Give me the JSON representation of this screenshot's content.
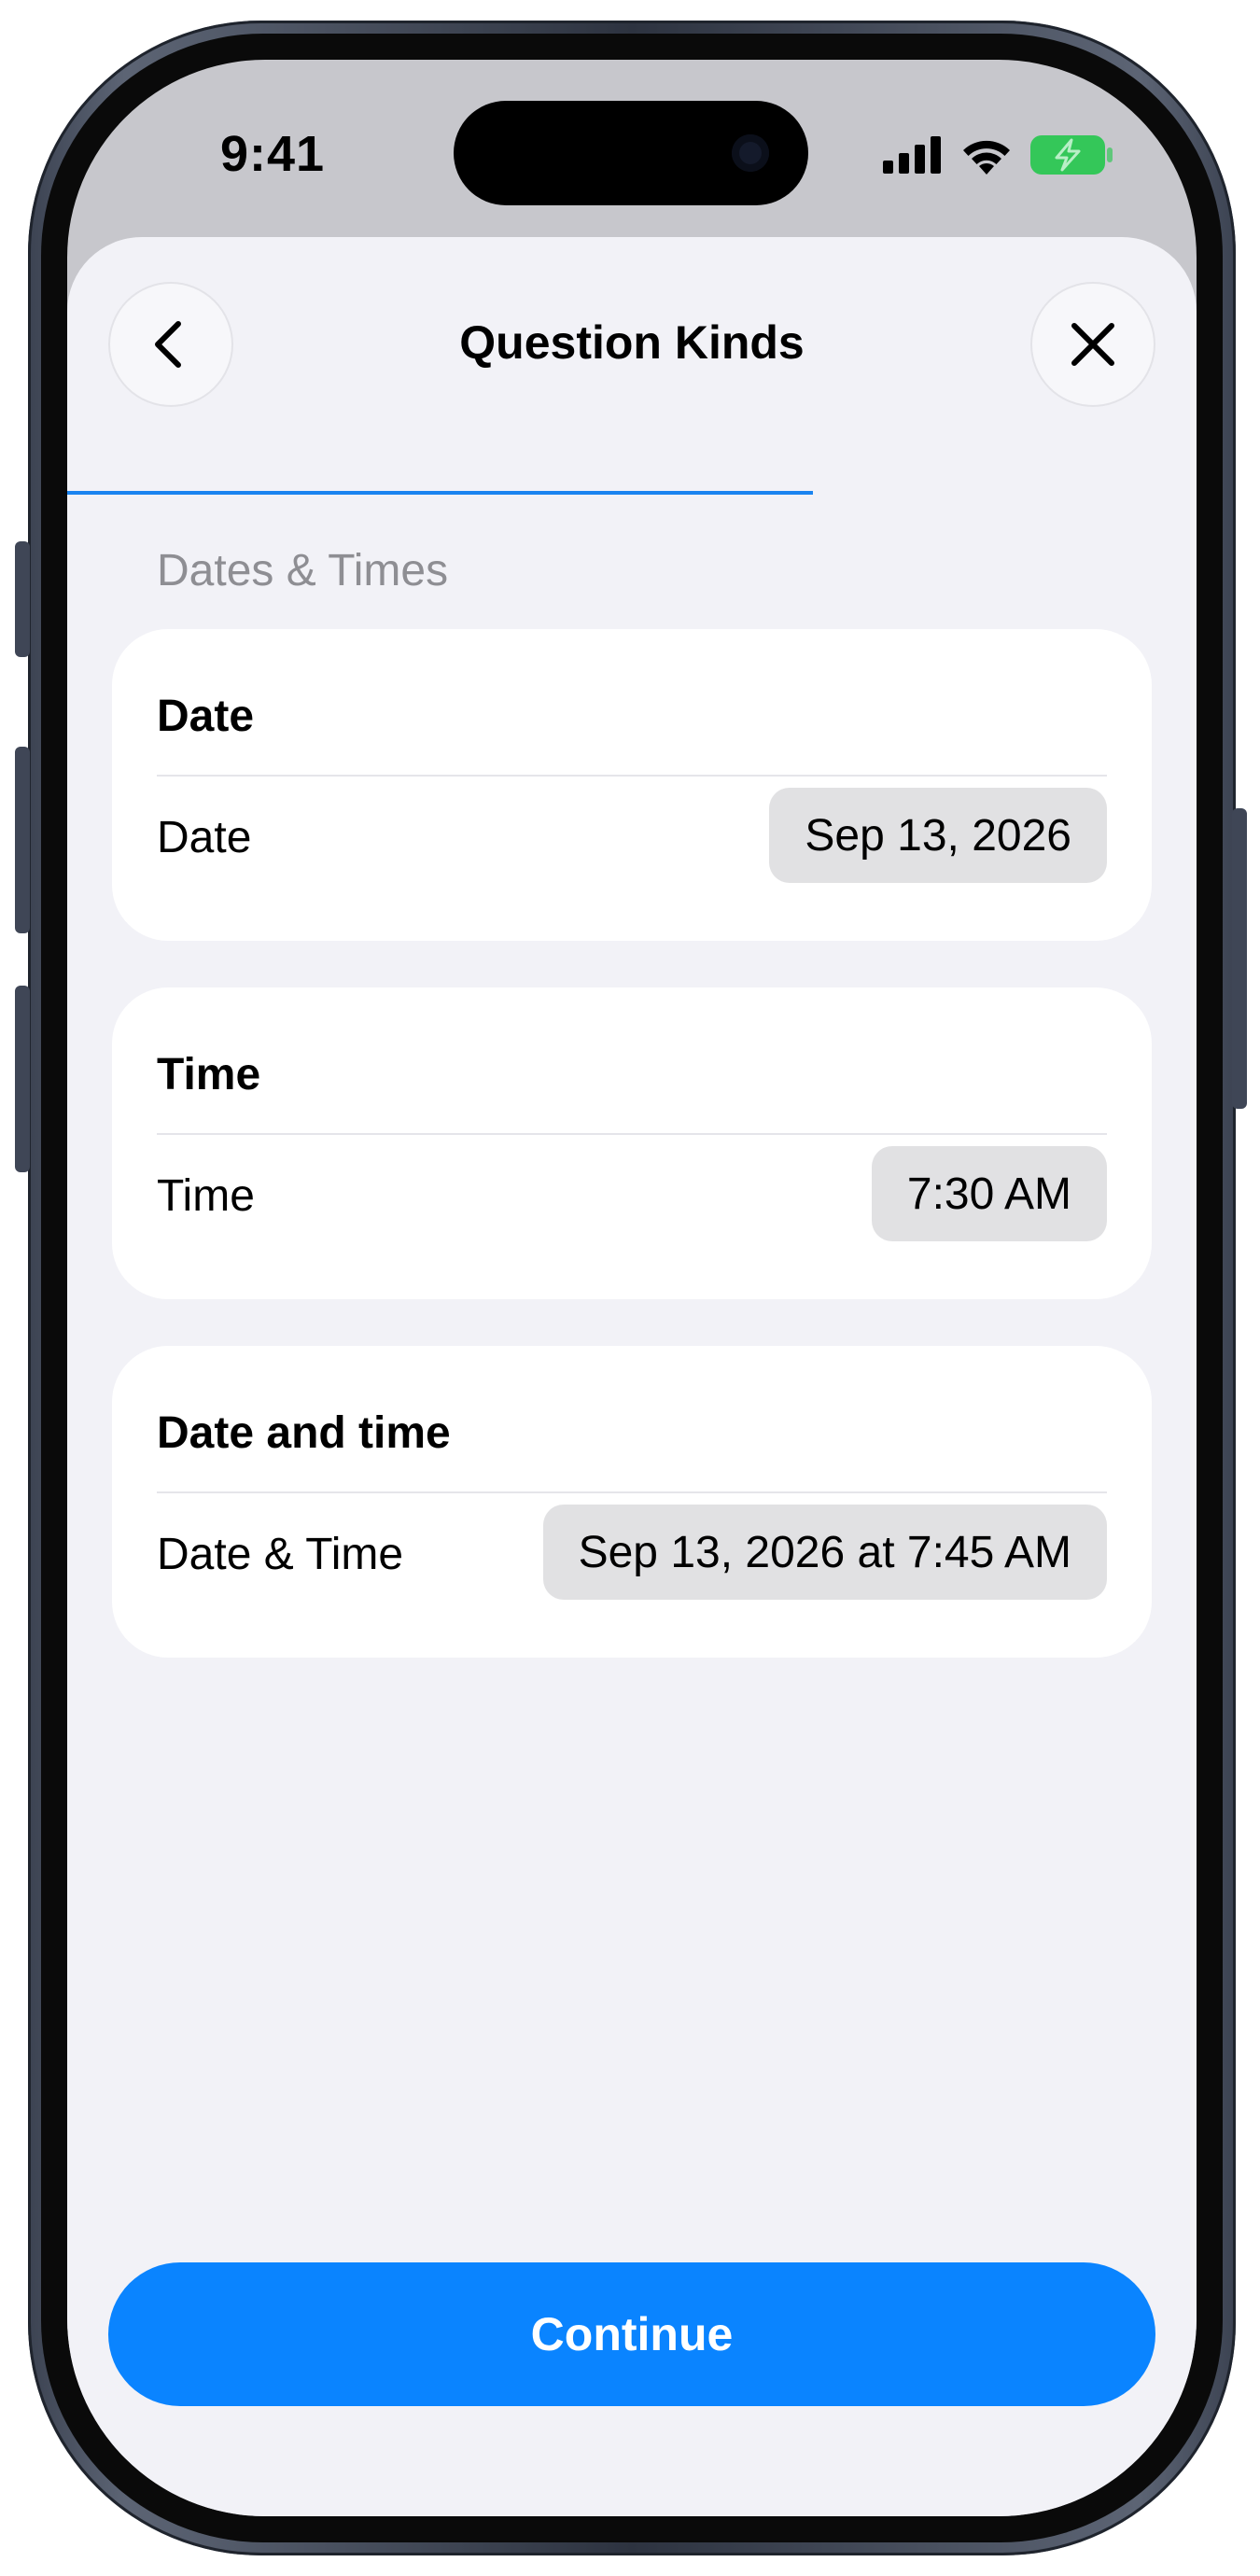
{
  "status_bar": {
    "time": "9:41",
    "icons": [
      "cellular-signal-icon",
      "wifi-icon",
      "battery-charging-icon"
    ],
    "battery_color": "#34c759"
  },
  "header": {
    "title": "Question Kinds",
    "back_icon": "chevron-left-icon",
    "close_icon": "close-icon",
    "progress_fraction": 0.66,
    "progress_color": "#1a84f0"
  },
  "section": {
    "title": "Dates & Times"
  },
  "cards": [
    {
      "title": "Date",
      "label": "Date",
      "value": "Sep 13, 2026"
    },
    {
      "title": "Time",
      "label": "Time",
      "value": "7:30 AM"
    },
    {
      "title": "Date and time",
      "label": "Date & Time",
      "value": "Sep 13, 2026 at 7:45 AM"
    }
  ],
  "footer": {
    "continue_label": "Continue",
    "accent_color": "#0a84ff"
  }
}
